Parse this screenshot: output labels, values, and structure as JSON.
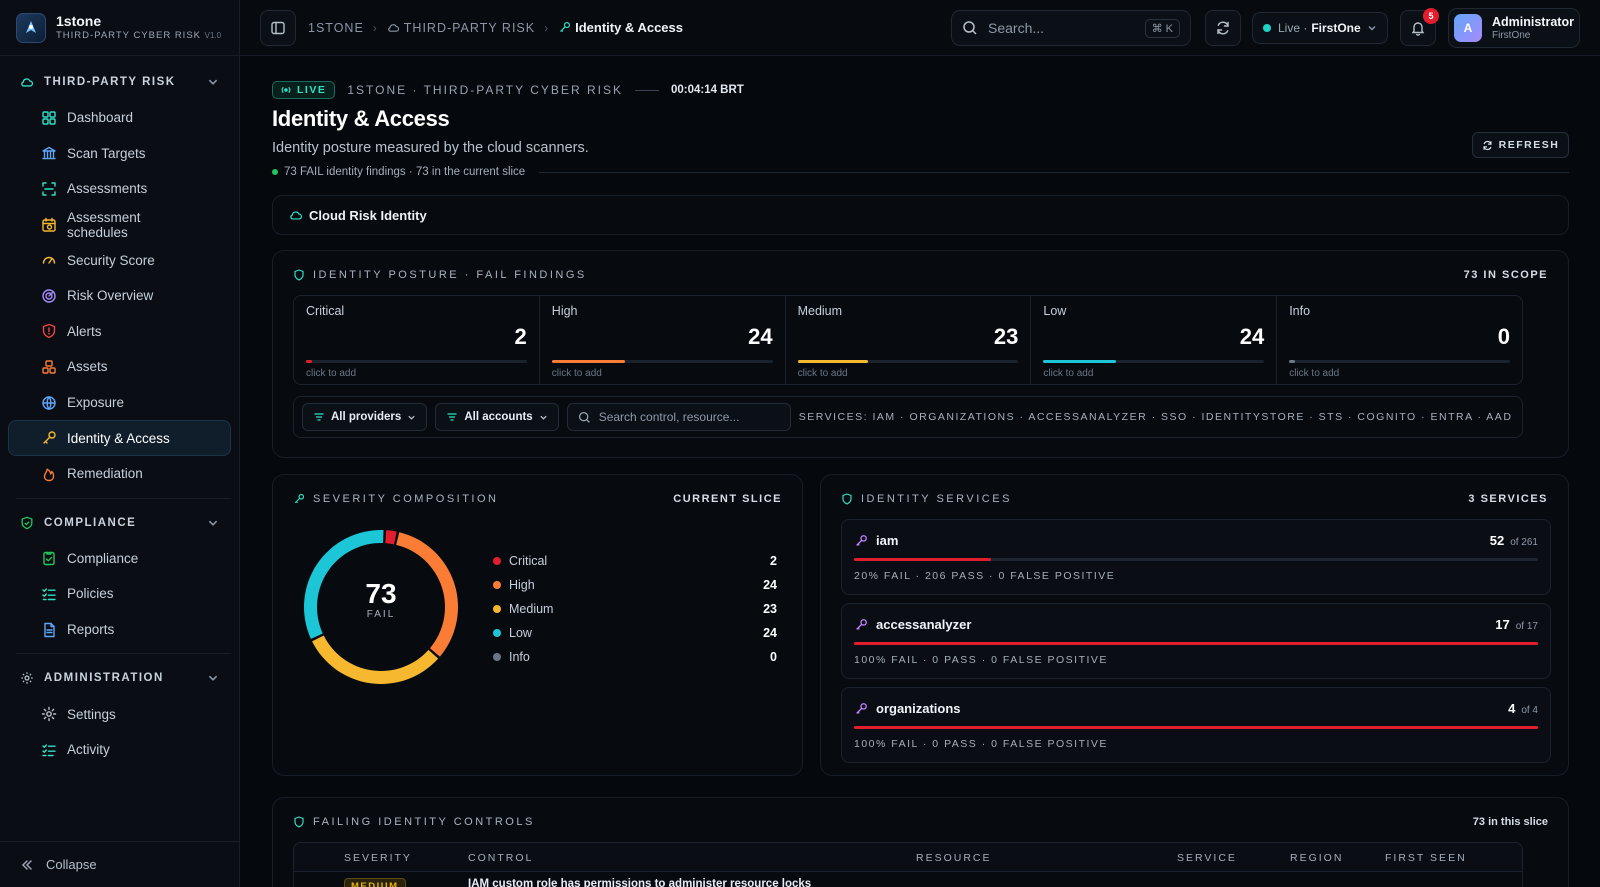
{
  "brand": {
    "name": "1stone",
    "subtitle": "THIRD-PARTY CYBER RISK",
    "version": "V1.0"
  },
  "sidebar": {
    "sections": [
      {
        "title": "THIRD-PARTY RISK",
        "items": [
          {
            "label": "Dashboard",
            "icon": "dashboard-icon"
          },
          {
            "label": "Scan Targets",
            "icon": "bank-icon"
          },
          {
            "label": "Assessments",
            "icon": "scan-icon"
          },
          {
            "label": "Assessment schedules",
            "icon": "calendar-icon"
          },
          {
            "label": "Security Score",
            "icon": "gauge-icon"
          },
          {
            "label": "Risk Overview",
            "icon": "radar-icon"
          },
          {
            "label": "Alerts",
            "icon": "shield-alert-icon"
          },
          {
            "label": "Assets",
            "icon": "boxes-icon"
          },
          {
            "label": "Exposure",
            "icon": "globe-icon"
          },
          {
            "label": "Identity & Access",
            "icon": "key-icon",
            "active": true
          },
          {
            "label": "Remediation",
            "icon": "flame-icon"
          }
        ]
      },
      {
        "title": "COMPLIANCE",
        "items": [
          {
            "label": "Compliance",
            "icon": "clipboard-check-icon"
          },
          {
            "label": "Policies",
            "icon": "list-check-icon"
          },
          {
            "label": "Reports",
            "icon": "file-icon"
          }
        ]
      },
      {
        "title": "ADMINISTRATION",
        "items": [
          {
            "label": "Settings",
            "icon": "gear-icon"
          },
          {
            "label": "Activity",
            "icon": "activity-list-icon"
          }
        ]
      }
    ],
    "collapse_label": "Collapse"
  },
  "topbar": {
    "breadcrumb": [
      "1STONE",
      "THIRD-PARTY RISK",
      "Identity & Access"
    ],
    "search_placeholder": "Search...",
    "search_kbd": "⌘ K",
    "live_label": "Live ·",
    "org": "FirstOne",
    "notifications": "5",
    "user_initial": "A",
    "user_name": "Administrator",
    "user_org": "FirstOne"
  },
  "header": {
    "live_badge": "LIVE",
    "org_line": "1STONE · THIRD-PARTY CYBER RISK",
    "time": "00:04:14 BRT",
    "title": "Identity & Access",
    "subtitle": "Identity posture measured by the cloud scanners.",
    "meta": "73 FAIL identity findings · 73 in the current slice",
    "refresh_label": "REFRESH",
    "tab": "Cloud Risk Identity"
  },
  "posture": {
    "title": "IDENTITY POSTURE · FAIL FINDINGS",
    "scope": "73 IN SCOPE",
    "hint": "click to add",
    "cells": [
      {
        "label": "Critical",
        "value": "2",
        "fraction": 0.027,
        "color": "#e11d2e"
      },
      {
        "label": "High",
        "value": "24",
        "fraction": 0.33,
        "color": "#fb7c35"
      },
      {
        "label": "Medium",
        "value": "23",
        "fraction": 0.32,
        "color": "#f5b82e"
      },
      {
        "label": "Low",
        "value": "24",
        "fraction": 0.33,
        "color": "#1cc6d6"
      },
      {
        "label": "Info",
        "value": "0",
        "fraction": 0,
        "color": "#6b7685"
      }
    ]
  },
  "filters": {
    "providers": "All providers",
    "accounts": "All accounts",
    "search_placeholder": "Search control, resource...",
    "services": "SERVICES: IAM · ORGANIZATIONS · ACCESSANALYZER · SSO · IDENTITYSTORE · STS · COGNITO · ENTRA · AAD"
  },
  "composition": {
    "title": "SEVERITY COMPOSITION",
    "right": "CURRENT SLICE",
    "total": "73",
    "total_label": "FAIL",
    "legend": [
      {
        "label": "Critical",
        "value": "2",
        "color": "#e11d2e"
      },
      {
        "label": "High",
        "value": "24",
        "color": "#fb7c35"
      },
      {
        "label": "Medium",
        "value": "23",
        "color": "#f5b82e"
      },
      {
        "label": "Low",
        "value": "24",
        "color": "#1cc6d6"
      },
      {
        "label": "Info",
        "value": "0",
        "color": "#6b7685"
      }
    ]
  },
  "chart_data": {
    "type": "pie",
    "categories": [
      "Critical",
      "High",
      "Medium",
      "Low",
      "Info"
    ],
    "values": [
      2,
      24,
      23,
      24,
      0
    ],
    "colors": [
      "#e11d2e",
      "#fb7c35",
      "#f5b82e",
      "#1cc6d6",
      "#6b7685"
    ]
  },
  "services": {
    "title": "IDENTITY SERVICES",
    "right": "3 SERVICES",
    "items": [
      {
        "name": "iam",
        "count": "52",
        "of": "of 261",
        "fraction": 0.2,
        "meta": "20% FAIL · 206 PASS · 0 FALSE POSITIVE"
      },
      {
        "name": "accessanalyzer",
        "count": "17",
        "of": "of 17",
        "fraction": 1.0,
        "meta": "100% FAIL · 0 PASS · 0 FALSE POSITIVE"
      },
      {
        "name": "organizations",
        "count": "4",
        "of": "of 4",
        "fraction": 1.0,
        "meta": "100% FAIL · 0 PASS · 0 FALSE POSITIVE"
      }
    ]
  },
  "failing": {
    "title": "FAILING IDENTITY CONTROLS",
    "right": "73 in this slice",
    "columns": [
      "SEVERITY",
      "CONTROL",
      "RESOURCE",
      "SERVICE",
      "REGION",
      "FIRST SEEN"
    ],
    "row": {
      "severity": "MEDIUM",
      "control": "IAM custom role has permissions to administer resource locks"
    }
  }
}
